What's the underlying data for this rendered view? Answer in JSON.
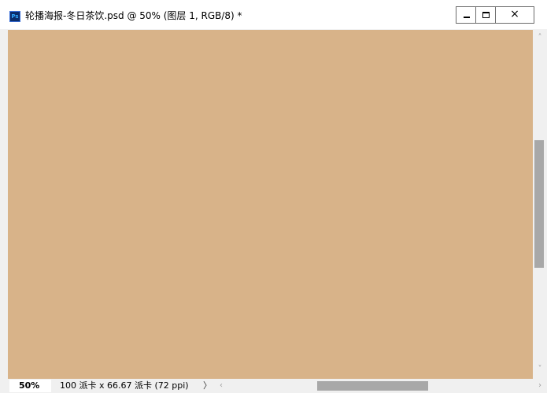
{
  "window": {
    "app_icon_text": "Ps",
    "title": "轮播海报-冬日茶饮.psd @ 50% (图层 1, RGB/8) *",
    "close_label": "×"
  },
  "canvas": {
    "fill_color": "#d8b389"
  },
  "scrollbars": {
    "up_arrow": "˄",
    "down_arrow": "˅",
    "left_arrow": "‹",
    "right_arrow": "›"
  },
  "status": {
    "zoom": "50%",
    "doc_info": "100 派卡 x 66.67 派卡 (72 ppi)",
    "info_arrow": "〉"
  }
}
